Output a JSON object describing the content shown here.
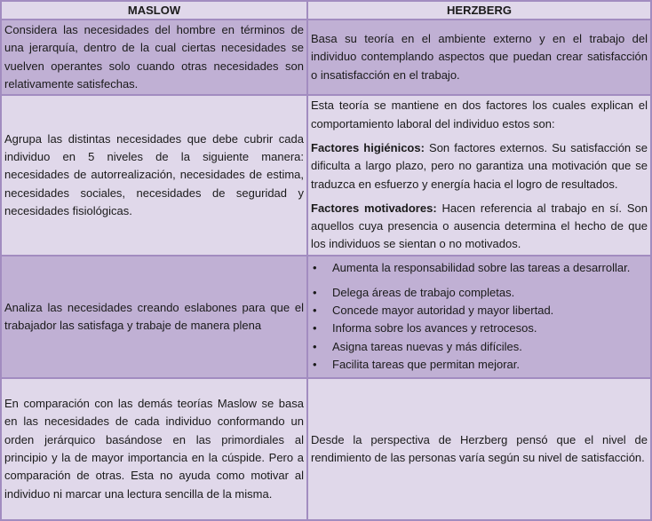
{
  "table": {
    "headers": [
      "MASLOW",
      "HERZBERG"
    ],
    "rows": [
      {
        "maslow": "Considera las necesidades del hombre en términos de una jerarquía, dentro de la cual ciertas necesidades se vuelven operantes solo cuando otras necesidades son relativamente satisfechas.",
        "herzberg": "Basa su teoría en el ambiente externo y en el trabajo del individuo contemplando aspectos que puedan crear satisfacción o insatisfacción en el trabajo."
      },
      {
        "maslow": "Agrupa las distintas necesidades que debe cubrir cada individuo en 5 niveles de la siguiente manera: necesidades de autorrealización, necesidades de estima, necesidades sociales, necesidades de seguridad y necesidades fisiológicas.",
        "herzberg": {
          "intro": "Esta teoría se mantiene en dos factores los cuales explican el comportamiento laboral del individuo estos son:",
          "factors": [
            {
              "label": "Factores higiénicos:",
              "text": " Son factores externos. Su satisfacción se dificulta a largo plazo, pero no garantiza una motivación que se traduzca en esfuerzo y energía hacia el logro de resultados."
            },
            {
              "label": "Factores motivadores:",
              "text": " Hacen referencia al trabajo en sí. Son aquellos cuya presencia o ausencia determina el hecho de que los individuos se sientan o no motivados."
            }
          ]
        }
      },
      {
        "maslow": "Analiza las necesidades creando eslabones para que el trabajador las satisfaga y trabaje de manera plena",
        "herzberg": {
          "bullet_icon": "•",
          "items": [
            "Aumenta la responsabilidad sobre las tareas a desarrollar.",
            "Delega áreas de trabajo completas.",
            "Concede mayor autoridad y mayor libertad.",
            "Informa sobre los avances y retrocesos.",
            "Asigna tareas nuevas y más difíciles.",
            "Facilita tareas que permitan mejorar."
          ]
        }
      },
      {
        "maslow": "En comparación con las demás teorías Maslow se basa en las necesidades de cada individuo conformando un orden jerárquico basándose en las primordiales al principio y la de mayor importancia en la cúspide. Pero a comparación de otras. Esta no ayuda como motivar al individuo ni marcar una lectura sencilla de la misma.",
        "herzberg": "Desde la perspectiva de Herzberg pensó que el nivel de rendimiento de las personas varía según su nivel de satisfacción."
      }
    ]
  },
  "colors": {
    "border": "#a28cc0",
    "light_row": "#e0d8ea",
    "dark_row": "#c0b0d4",
    "text": "#1a1a1a"
  }
}
